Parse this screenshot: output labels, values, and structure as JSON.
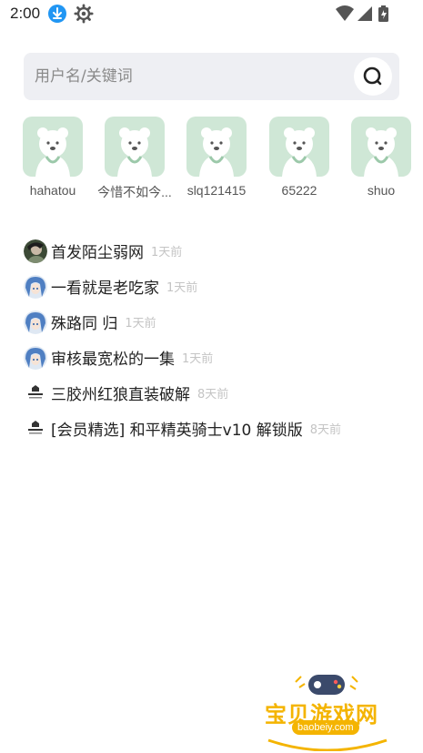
{
  "status_bar": {
    "time": "2:00",
    "icons": [
      "download-icon",
      "gear-icon",
      "wifi-icon",
      "signal-icon",
      "battery-icon"
    ]
  },
  "search": {
    "placeholder": "用户名/关键词",
    "icon": "search-icon"
  },
  "users": [
    {
      "name": "hahatou"
    },
    {
      "name": "今惜不如今..."
    },
    {
      "name": "slq121415"
    },
    {
      "name": "65222"
    },
    {
      "name": "shuo"
    }
  ],
  "posts": [
    {
      "title": "首发陌尘弱网",
      "time": "1天前",
      "avatar": "dark"
    },
    {
      "title": "一看就是老吃家",
      "time": "1天前",
      "avatar": "anime"
    },
    {
      "title": "殊路同 归",
      "time": "1天前",
      "avatar": "anime"
    },
    {
      "title": "审核最宽松的一集",
      "time": "1天前",
      "avatar": "anime"
    },
    {
      "title": "三胶州红狼直装破解",
      "time": "8天前",
      "avatar": "logo"
    },
    {
      "title": "[会员精选] 和平精英骑士v10 解锁版",
      "time": "8天前",
      "avatar": "logo"
    }
  ],
  "watermark": {
    "title": "宝贝游戏网",
    "url": "baobeiy.com"
  },
  "colors": {
    "accent": "#2196f3",
    "avatar_bg": "#cfe7d6",
    "search_bg": "#eeeff3",
    "watermark": "#f4b400"
  }
}
